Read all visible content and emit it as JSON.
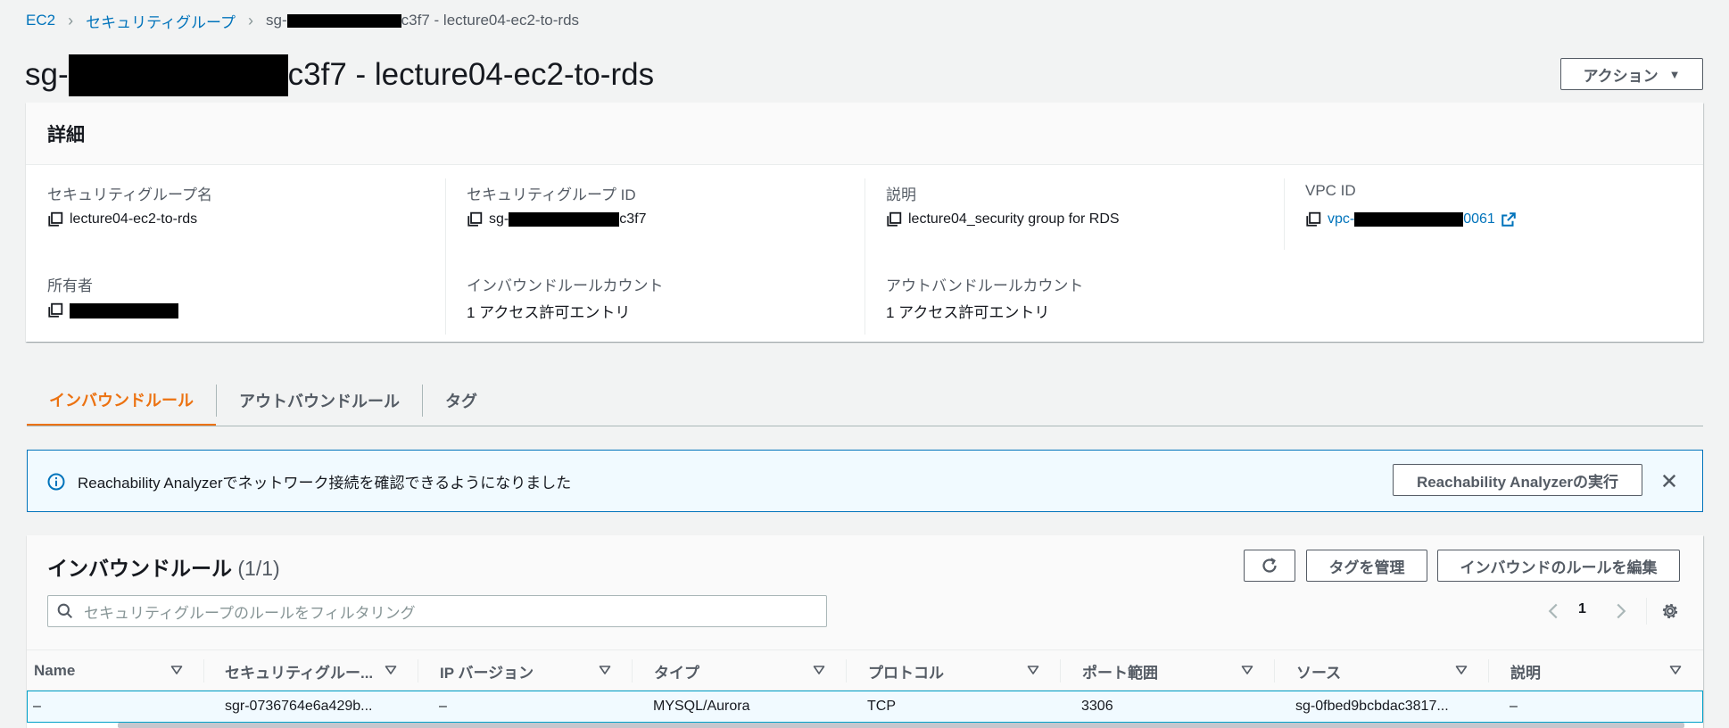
{
  "breadcrumb": {
    "items": [
      "EC2",
      "セキュリティグループ"
    ],
    "current_prefix": "sg-",
    "current_suffix": "c3f7 - lecture04-ec2-to-rds"
  },
  "title": {
    "prefix": "sg-",
    "suffix": "c3f7 - lecture04-ec2-to-rds"
  },
  "actions_button": "アクション",
  "details": {
    "header": "詳細",
    "fields": {
      "sg_name": {
        "label": "セキュリティグループ名",
        "value": "lecture04-ec2-to-rds"
      },
      "sg_id": {
        "label": "セキュリティグループ ID",
        "prefix": "sg-",
        "suffix": "c3f7"
      },
      "description": {
        "label": "説明",
        "value": "lecture04_security group for RDS"
      },
      "vpc_id": {
        "label": "VPC ID",
        "prefix": "vpc-",
        "suffix": "0061"
      },
      "owner": {
        "label": "所有者"
      },
      "inbound_count": {
        "label": "インバウンドルールカウント",
        "value": "1 アクセス許可エントリ"
      },
      "outbound_count": {
        "label": "アウトバンドルールカウント",
        "value": "1 アクセス許可エントリ"
      }
    }
  },
  "tabs": [
    "インバウンドルール",
    "アウトバウンドルール",
    "タグ"
  ],
  "banner": {
    "text": "Reachability Analyzerでネットワーク接続を確認できるようになりました",
    "button": "Reachability Analyzerの実行"
  },
  "rules": {
    "title": "インバウンドルール",
    "count": "(1/1)",
    "buttons": {
      "manage_tags": "タグを管理",
      "edit_rules": "インバウンドのルールを編集"
    },
    "search_placeholder": "セキュリティグループのルールをフィルタリング",
    "page": "1",
    "columns": [
      "Name",
      "セキュリティグルー...",
      "IP バージョン",
      "タイプ",
      "プロトコル",
      "ポート範囲",
      "ソース",
      "説明"
    ],
    "rows": [
      [
        "–",
        "sgr-0736764e6a429b...",
        "–",
        "MYSQL/Aurora",
        "TCP",
        "3306",
        "sg-0fbed9bcbdac3817...",
        "–"
      ]
    ]
  },
  "colors": {
    "link": "#0073bb",
    "active_tab": "#ec7211",
    "banner_border": "#0073bb",
    "banner_bg": "#f1faff"
  }
}
